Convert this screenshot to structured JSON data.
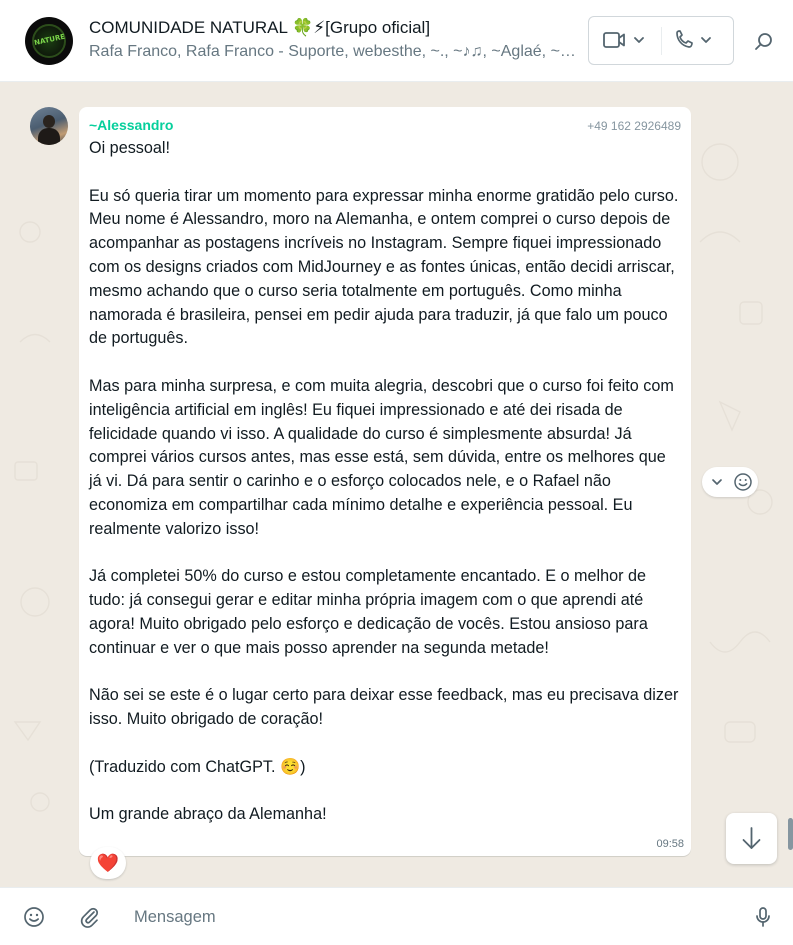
{
  "header": {
    "group_title": "COMUNIDADE NATURAL 🍀⚡[Grupo oficial]",
    "members": "Rafa Franco, Rafa Franco - Suporte, webesthe, ~., ~♪♫, ~Aglaé, ~Alessandro",
    "avatar_logo_text": "NATURE",
    "icons": {
      "video": "video-call-icon",
      "voice": "phone-call-icon",
      "search": "search-icon"
    }
  },
  "message": {
    "sender_name": "~Alessandro",
    "sender_phone": "+49 162 2926489",
    "text": "Oi pessoal!\n\nEu só queria tirar um momento para expressar minha enorme gratidão pelo curso. Meu nome é Alessandro, moro na Alemanha, e ontem comprei o curso depois de acompanhar as postagens incríveis no Instagram. Sempre fiquei impressionado com os designs criados com MidJourney e as fontes únicas, então decidi arriscar, mesmo achando que o curso seria totalmente em português. Como minha namorada é brasileira, pensei em pedir ajuda para traduzir, já que falo um pouco de português.\n\nMas para minha surpresa, e com muita alegria, descobri que o curso foi feito com inteligência artificial em inglês! Eu fiquei impressionado e até dei risada de felicidade quando vi isso. A qualidade do curso é simplesmente absurda! Já comprei vários cursos antes, mas esse está, sem dúvida, entre os melhores que já vi. Dá para sentir o carinho e o esforço colocados nele, e o Rafael não economiza em compartilhar cada mínimo detalhe e experiência pessoal. Eu realmente valorizo isso!\n\nJá completei 50% do curso e estou completamente encantado. E o melhor de tudo: já consegui gerar e editar minha própria imagem com o que aprendi até agora! Muito obrigado pelo esforço e dedicação de vocês. Estou ansioso para continuar e ver o que mais posso aprender na segunda metade!\n\nNão sei se este é o lugar certo para deixar esse feedback, mas eu precisava dizer isso. Muito obrigado de coração!\n\n(Traduzido com ChatGPT. ☺️)\n\nUm grande abraço da Alemanha!",
    "time": "09:58",
    "reaction": "❤️"
  },
  "footer": {
    "placeholder": "Mensagem",
    "icons": {
      "emoji": "emoji-icon",
      "attach": "paperclip-icon",
      "mic": "microphone-icon"
    }
  },
  "colors": {
    "sender_name": "#06cf9c",
    "chat_background": "#efeae2",
    "bubble": "#ffffff",
    "secondary_text": "#667781"
  }
}
